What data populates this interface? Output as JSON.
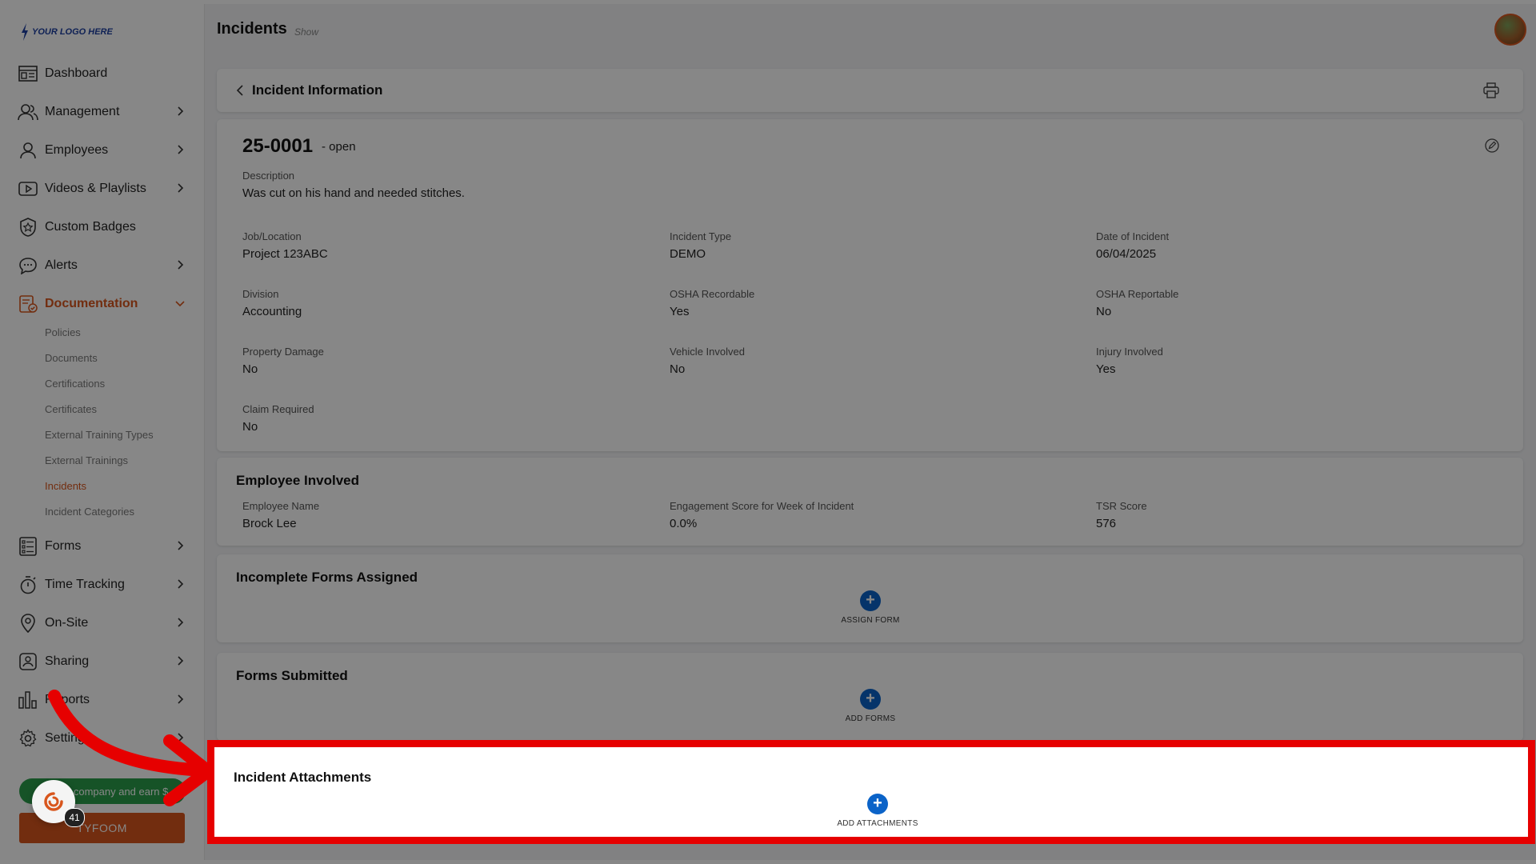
{
  "brand": {
    "logo_text": "YOUR LOGO HERE"
  },
  "header": {
    "title": "Incidents",
    "subtitle": "Show"
  },
  "sidebar": {
    "items": [
      {
        "label": "Dashboard",
        "icon": "dashboard-icon"
      },
      {
        "label": "Management",
        "icon": "users-icon"
      },
      {
        "label": "Employees",
        "icon": "user-icon"
      },
      {
        "label": "Videos & Playlists",
        "icon": "play-icon"
      },
      {
        "label": "Custom Badges",
        "icon": "badge-icon"
      },
      {
        "label": "Alerts",
        "icon": "chat-icon"
      },
      {
        "label": "Documentation",
        "icon": "document-check-icon"
      },
      {
        "label": "Forms",
        "icon": "list-icon"
      },
      {
        "label": "Time Tracking",
        "icon": "stopwatch-icon"
      },
      {
        "label": "On-Site",
        "icon": "location-icon"
      },
      {
        "label": "Sharing",
        "icon": "share-icon"
      },
      {
        "label": "Reports",
        "icon": "bar-chart-icon"
      },
      {
        "label": "Settings",
        "icon": "gear-icon"
      }
    ],
    "sub_items": [
      "Policies",
      "Documents",
      "Certifications",
      "Certificates",
      "External Training Types",
      "External Trainings",
      "Incidents",
      "Incident Categories"
    ],
    "active_sub": "Incidents",
    "promo": "Refer a company and earn $",
    "cta": "TYFOOM",
    "notification_count": "41"
  },
  "incident": {
    "section_title": "Incident Information",
    "number": "25-0001",
    "status": "- open",
    "description_label": "Description",
    "description": "Was cut on his hand and needed stitches.",
    "fields": [
      {
        "label": "Job/Location",
        "value": "Project 123ABC"
      },
      {
        "label": "Incident Type",
        "value": "DEMO"
      },
      {
        "label": "Date of Incident",
        "value": "06/04/2025"
      },
      {
        "label": "Division",
        "value": "Accounting"
      },
      {
        "label": "OSHA Recordable",
        "value": "Yes"
      },
      {
        "label": "OSHA Reportable",
        "value": "No"
      },
      {
        "label": "Property Damage",
        "value": "No"
      },
      {
        "label": "Vehicle Involved",
        "value": "No"
      },
      {
        "label": "Injury Involved",
        "value": "Yes"
      },
      {
        "label": "Claim Required",
        "value": "No"
      }
    ]
  },
  "employee": {
    "title": "Employee Involved",
    "fields": [
      {
        "label": "Employee Name",
        "value": "Brock Lee"
      },
      {
        "label": "Engagement Score for Week of Incident",
        "value": "0.0%"
      },
      {
        "label": "TSR Score",
        "value": "576"
      }
    ]
  },
  "incomplete_forms": {
    "title": "Incomplete Forms Assigned",
    "action": "ASSIGN FORM"
  },
  "forms_submitted": {
    "title": "Forms Submitted",
    "action": "ADD FORMS"
  },
  "attachments": {
    "title": "Incident Attachments",
    "action": "ADD ATTACHMENTS"
  },
  "colors": {
    "accent": "#d8561d",
    "primary": "#0b63c8",
    "highlight": "#e60000",
    "promo": "#2a9d4a"
  }
}
